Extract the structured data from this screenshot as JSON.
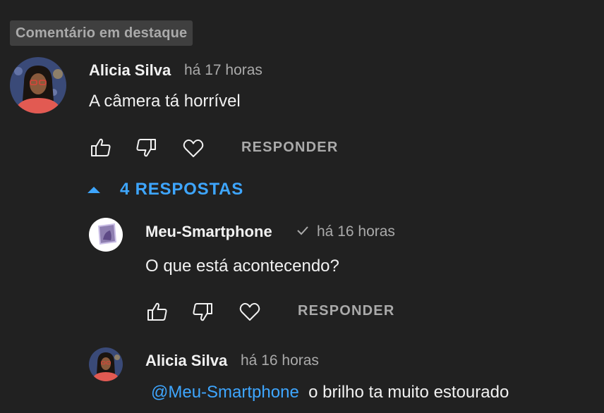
{
  "featured_badge": "Comentário em destaque",
  "comment": {
    "author": "Alicia Silva",
    "time": "há 17 horas",
    "text": "A câmera tá horrível",
    "reply_label": "RESPONDER"
  },
  "replies_toggle": {
    "label": "4 RESPOSTAS",
    "icon": "chevron-up-icon"
  },
  "replies": [
    {
      "author": "Meu-Smartphone",
      "verified": true,
      "time": "há 16 horas",
      "text": "O que está acontecendo?",
      "reply_label": "RESPONDER"
    },
    {
      "author": "Alicia Silva",
      "time": "há 16 horas",
      "mention": "@Meu-Smartphone",
      "text": "o brilho ta muito estourado"
    }
  ],
  "colors": {
    "background": "#212121",
    "link_blue": "#3ea6ff",
    "muted_text": "#aaaaaa"
  }
}
